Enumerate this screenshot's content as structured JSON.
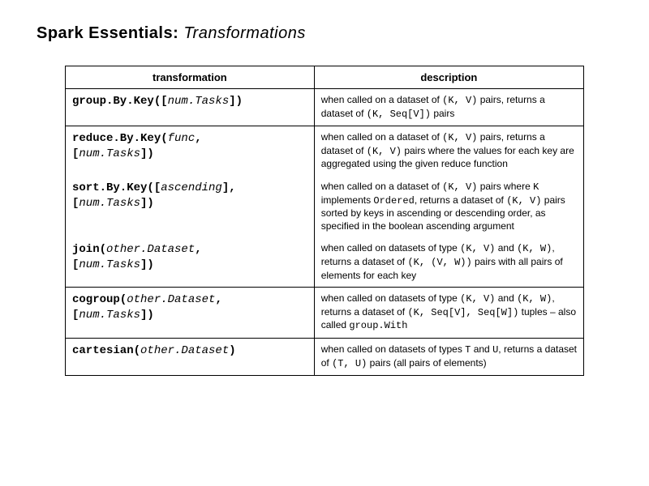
{
  "title_bold": "Spark Essentials: ",
  "title_ital": "Transformations",
  "headers": {
    "c1": "transformation",
    "c2": "description"
  },
  "rows": [
    {
      "t_pre": "group.By.Key([",
      "t_param": "num.Tasks",
      "t_post": "])",
      "d_pre": "when called on a dataset of ",
      "d_m1": "(K, V)",
      "d_mid": " pairs, returns a dataset of ",
      "d_m2": "(K, Seq[V])",
      "d_post": " pairs"
    },
    {
      "t_pre": "reduce.By.Key(",
      "t_p1": "func",
      "t_mid": ",\n [",
      "t_p2": "num.Tasks",
      "t_post": "])",
      "d_pre": "when called on a dataset of ",
      "d_m1": "(K, V)",
      "d_mid1": " pairs, returns a dataset of ",
      "d_m2": "(K, V)",
      "d_post": " pairs where the values for each key are aggregated using the given reduce function"
    },
    {
      "t_pre": "sort.By.Key([",
      "t_p1": "ascending",
      "t_mid": "],\n [",
      "t_p2": "num.Tasks",
      "t_post": "])",
      "d_pre": "when called on a dataset of ",
      "d_m1": "(K, V)",
      "d_mid1": " pairs where ",
      "d_m2": "K",
      "d_mid2": " implements ",
      "d_m3": "Ordered",
      "d_mid3": ", returns a dataset of ",
      "d_m4": "(K, V)",
      "d_post": " pairs sorted by keys in ascending or descending order, as specified in the boolean ascending argument"
    },
    {
      "t_pre": "join(",
      "t_p1": "other.Dataset",
      "t_mid": ",\n [",
      "t_p2": "num.Tasks",
      "t_post": "])",
      "d_pre": "when called on datasets of type ",
      "d_m1": "(K, V)",
      "d_mid1": " and ",
      "d_m2": "(K, W)",
      "d_mid2": ", returns a dataset of ",
      "d_m3": "(K, (V, W))",
      "d_post": " pairs with all pairs of elements for each key"
    },
    {
      "t_pre": "cogroup(",
      "t_p1": "other.Dataset",
      "t_mid": ",\n [",
      "t_p2": "num.Tasks",
      "t_post": "])",
      "d_pre": "when called on datasets of type ",
      "d_m1": "(K, V)",
      "d_mid1": " and ",
      "d_m2": "(K, W)",
      "d_mid2": ", returns a dataset of ",
      "d_m3": "(K, Seq[V], Seq[W])",
      "d_mid3": " tuples – also called ",
      "d_m4": "group.With",
      "d_post": ""
    },
    {
      "t_pre": "cartesian(",
      "t_p1": "other.Dataset",
      "t_post": ")",
      "d_pre": "when called on datasets of types ",
      "d_m1": "T",
      "d_mid1": " and ",
      "d_m2": "U",
      "d_mid2": ", returns a dataset of ",
      "d_m3": "(T, U)",
      "d_post": " pairs (all pairs of elements)"
    }
  ]
}
